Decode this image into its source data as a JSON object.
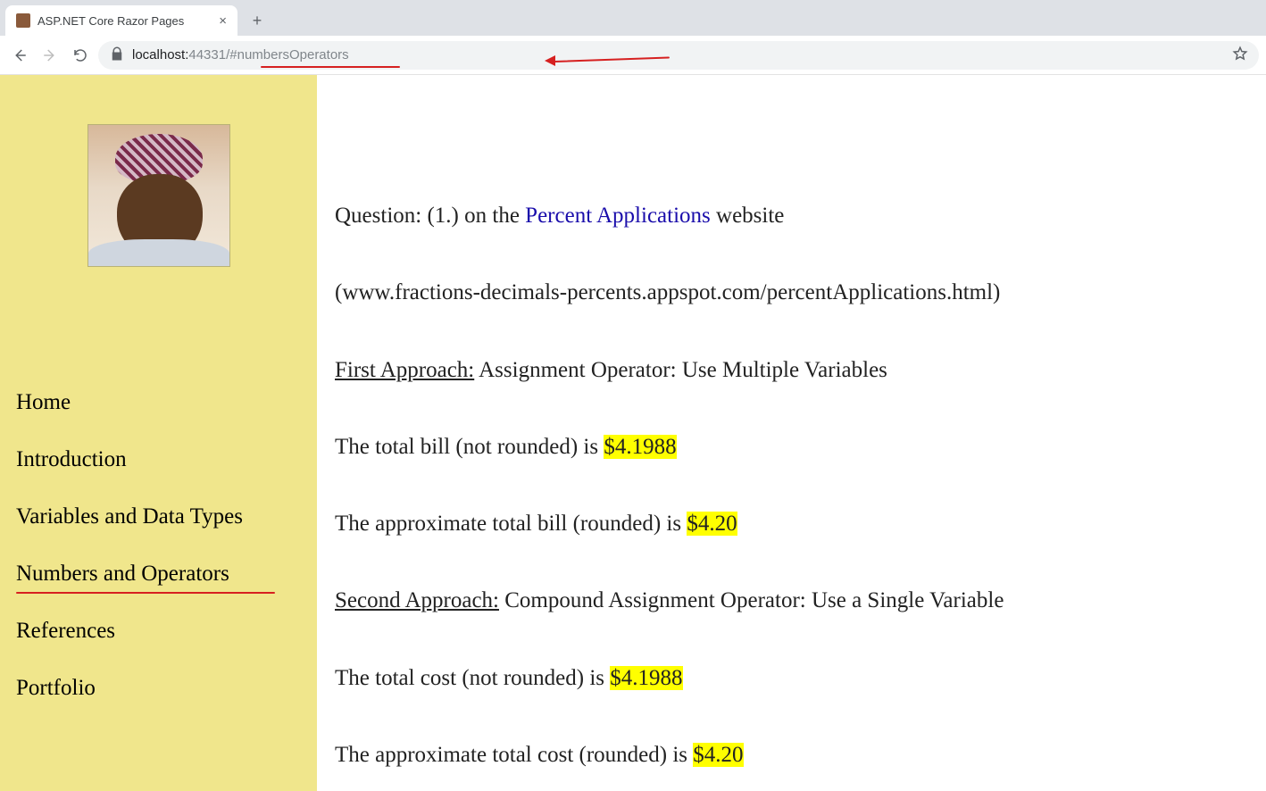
{
  "browser": {
    "tab_title": "ASP.NET Core Razor Pages",
    "url_host": "localhost:",
    "url_port": "44331",
    "url_path": "/#numbersOperators"
  },
  "sidebar": {
    "items": [
      {
        "label": "Home",
        "active": false
      },
      {
        "label": "Introduction",
        "active": false
      },
      {
        "label": "Variables and Data Types",
        "active": false
      },
      {
        "label": "Numbers and Operators",
        "active": true
      },
      {
        "label": "References",
        "active": false
      },
      {
        "label": "Portfolio",
        "active": false
      }
    ]
  },
  "content": {
    "q_prefix": "Question: (1.) on the ",
    "q_link": "Percent Applications",
    "q_suffix": " website",
    "q_url_line": "(www.fractions-decimals-percents.appspot.com/percentApplications.html)",
    "first_label": "First Approach:",
    "first_rest": " Assignment Operator: Use Multiple Variables",
    "bill_not_rounded_prefix": "The total bill (not rounded) is ",
    "bill_not_rounded_value": "$4.1988",
    "bill_rounded_prefix": "The approximate total bill (rounded) is ",
    "bill_rounded_value": "$4.20",
    "second_label": "Second Approach:",
    "second_rest": " Compound Assignment Operator: Use a Single Variable",
    "cost_not_rounded_prefix": "The total cost (not rounded) is ",
    "cost_not_rounded_value": "$4.1988",
    "cost_rounded_prefix": "The approximate total cost (rounded) is ",
    "cost_rounded_value": "$4.20"
  }
}
